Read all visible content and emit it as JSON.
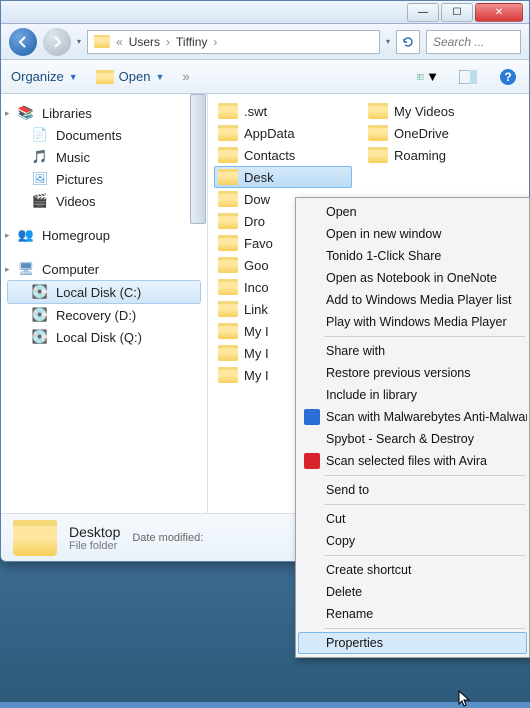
{
  "window": {
    "min": "—",
    "max": "☐",
    "close": "✕"
  },
  "nav": {
    "back": "←",
    "forward": "→",
    "dropdown": "▾",
    "refresh": "↻"
  },
  "breadcrumb": {
    "prefix": "«",
    "p1": "Users",
    "p2": "Tiffiny",
    "sep": "›"
  },
  "search": {
    "placeholder": "Search ..."
  },
  "toolbar": {
    "organize": "Organize",
    "open": "Open",
    "views": "▥",
    "preview": "▭",
    "help": "?"
  },
  "sidebar": {
    "libraries": "Libraries",
    "documents": "Documents",
    "music": "Music",
    "pictures": "Pictures",
    "videos": "Videos",
    "homegroup": "Homegroup",
    "computer": "Computer",
    "localc": "Local Disk (C:)",
    "recoveryd": "Recovery (D:)",
    "localq": "Local Disk (Q:)"
  },
  "folders_col1": [
    ".swt",
    "AppData",
    "Contacts",
    "Desktop",
    "Downloads",
    "Dropbox",
    "Favorites",
    "Google Drive",
    "Incoming",
    "Links",
    "My Documents",
    "My Music",
    "My Pictures"
  ],
  "folders_truncated": [
    ".swt",
    "AppData",
    "Contacts",
    "Desk",
    "Dow",
    "Dro",
    "Favo",
    "Goo",
    "Inco",
    "Link",
    "My I",
    "My I",
    "My I"
  ],
  "folders_col2": [
    "My Videos",
    "OneDrive",
    "Roaming"
  ],
  "details": {
    "name": "Desktop",
    "type": "File folder",
    "meta": "Date modified:"
  },
  "context": {
    "items": [
      {
        "label": "Open"
      },
      {
        "label": "Open in new window"
      },
      {
        "label": "Tonido 1-Click Share"
      },
      {
        "label": "Open as Notebook in OneNote"
      },
      {
        "label": "Add to Windows Media Player list"
      },
      {
        "label": "Play with Windows Media Player"
      },
      {
        "sep": true
      },
      {
        "label": "Share with"
      },
      {
        "label": "Restore previous versions"
      },
      {
        "label": "Include in library"
      },
      {
        "label": "Scan with Malwarebytes Anti-Malware",
        "icon": "#2b6fd6"
      },
      {
        "label": "Spybot - Search & Destroy"
      },
      {
        "label": "Scan selected files with Avira",
        "icon": "#d8232a"
      },
      {
        "sep": true
      },
      {
        "label": "Send to"
      },
      {
        "sep": true
      },
      {
        "label": "Cut"
      },
      {
        "label": "Copy"
      },
      {
        "sep": true
      },
      {
        "label": "Create shortcut"
      },
      {
        "label": "Delete"
      },
      {
        "label": "Rename"
      },
      {
        "sep": true
      },
      {
        "label": "Properties",
        "hover": true
      }
    ]
  }
}
